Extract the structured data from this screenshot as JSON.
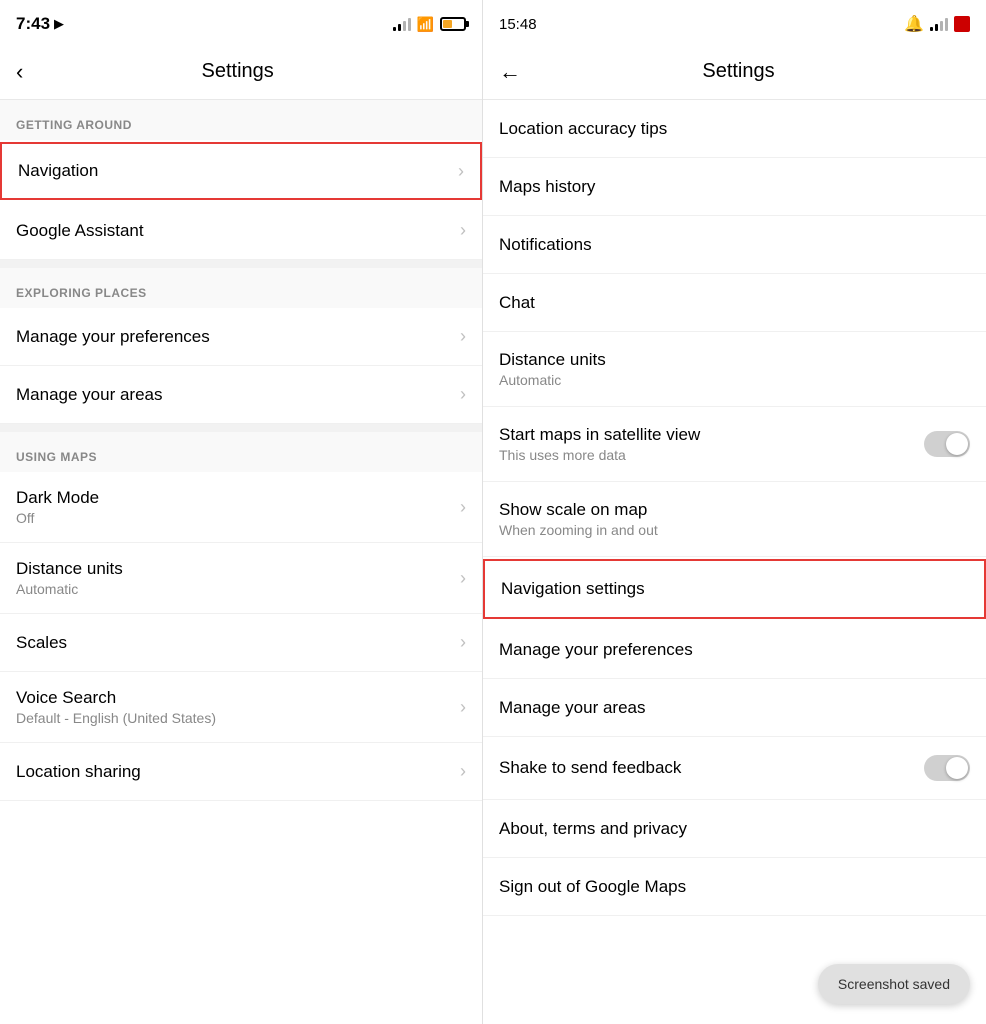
{
  "left": {
    "statusBar": {
      "time": "7:43",
      "locationIcon": "▶"
    },
    "header": {
      "backLabel": "‹",
      "title": "Settings"
    },
    "sections": [
      {
        "label": "GETTING AROUND",
        "items": [
          {
            "title": "Navigation",
            "subtitle": "",
            "hasChevron": true,
            "highlighted": true
          },
          {
            "title": "Google Assistant",
            "subtitle": "",
            "hasChevron": true,
            "highlighted": false
          }
        ]
      },
      {
        "label": "EXPLORING PLACES",
        "items": [
          {
            "title": "Manage your preferences",
            "subtitle": "",
            "hasChevron": true,
            "highlighted": false
          },
          {
            "title": "Manage your areas",
            "subtitle": "",
            "hasChevron": true,
            "highlighted": false
          }
        ]
      },
      {
        "label": "USING MAPS",
        "items": [
          {
            "title": "Dark Mode",
            "subtitle": "Off",
            "hasChevron": true,
            "highlighted": false
          },
          {
            "title": "Distance units",
            "subtitle": "Automatic",
            "hasChevron": true,
            "highlighted": false
          },
          {
            "title": "Scales",
            "subtitle": "",
            "hasChevron": true,
            "highlighted": false
          },
          {
            "title": "Voice Search",
            "subtitle": "Default - English (United States)",
            "hasChevron": true,
            "highlighted": false
          },
          {
            "title": "Location sharing",
            "subtitle": "",
            "hasChevron": true,
            "highlighted": false
          }
        ]
      }
    ]
  },
  "right": {
    "statusBar": {
      "time": "15:48"
    },
    "header": {
      "backLabel": "←",
      "title": "Settings"
    },
    "items": [
      {
        "title": "Location accuracy tips",
        "subtitle": "",
        "type": "chevron",
        "highlighted": false
      },
      {
        "title": "Maps history",
        "subtitle": "",
        "type": "chevron",
        "highlighted": false
      },
      {
        "title": "Notifications",
        "subtitle": "",
        "type": "chevron",
        "highlighted": false
      },
      {
        "title": "Chat",
        "subtitle": "",
        "type": "chevron",
        "highlighted": false
      },
      {
        "title": "Distance units",
        "subtitle": "Automatic",
        "type": "chevron",
        "highlighted": false
      },
      {
        "title": "Start maps in satellite view",
        "subtitle": "This uses more data",
        "type": "toggle",
        "highlighted": false
      },
      {
        "title": "Show scale on map",
        "subtitle": "When zooming in and out",
        "type": "none",
        "highlighted": false
      },
      {
        "title": "Navigation settings",
        "subtitle": "",
        "type": "chevron",
        "highlighted": true
      },
      {
        "title": "Manage your preferences",
        "subtitle": "",
        "type": "chevron",
        "highlighted": false
      },
      {
        "title": "Manage your areas",
        "subtitle": "",
        "type": "chevron",
        "highlighted": false
      },
      {
        "title": "Shake to send feedback",
        "subtitle": "",
        "type": "toggle",
        "highlighted": false
      },
      {
        "title": "About, terms and privacy",
        "subtitle": "",
        "type": "chevron",
        "highlighted": false
      },
      {
        "title": "Sign out of Google Maps",
        "subtitle": "",
        "type": "none",
        "highlighted": false
      }
    ],
    "toast": "Screenshot saved"
  },
  "icons": {
    "chevron": "›",
    "back": "‹",
    "backArrow": "←"
  }
}
